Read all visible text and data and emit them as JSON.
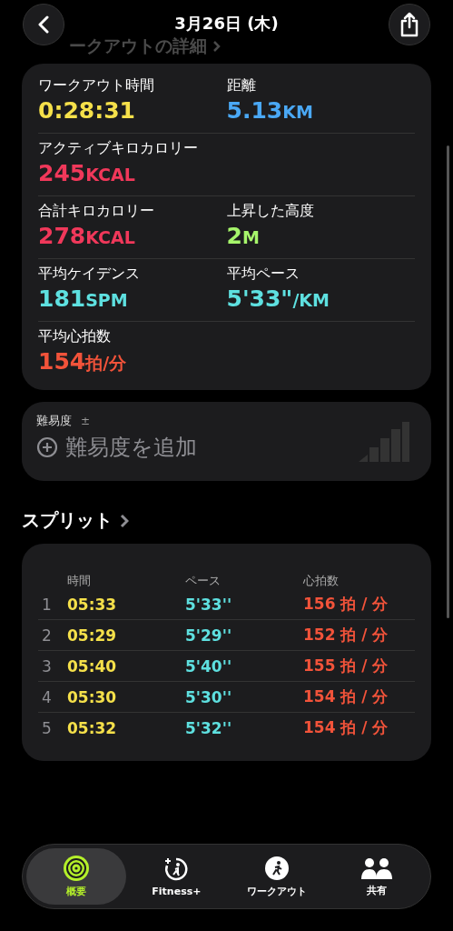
{
  "header": {
    "title": "3月26日 (木)",
    "section_title": "ークアウトの詳細"
  },
  "metrics": [
    {
      "label": "ワークアウト時間",
      "value": "0:28:31",
      "color": "#f5e04a"
    },
    {
      "label": "距離",
      "value": "5.13",
      "unit": "KM",
      "color": "#4aa8f5"
    },
    {
      "label": "アクティブキロカロリー",
      "value": "245",
      "unit": "KCAL",
      "color": "#f0385a"
    },
    {
      "label": "合計キロカロリー",
      "value": "278",
      "unit": "KCAL",
      "color": "#f0385a"
    },
    {
      "label": "上昇した高度",
      "value": "2",
      "unit": "M",
      "color": "#a6f56b"
    },
    {
      "label": "平均ケイデンス",
      "value": "181",
      "unit": "SPM",
      "color": "#5ee0e0"
    },
    {
      "label": "平均ペース",
      "value": "5'33\"",
      "unit": "/KM",
      "color": "#5ee0e0"
    },
    {
      "label": "平均心拍数",
      "value": "154",
      "unit": "拍/分",
      "color": "#f2533a"
    }
  ],
  "difficulty": {
    "label": "難易度",
    "mark": "±",
    "placeholder": "難易度を追加"
  },
  "splits": {
    "title": "スプリット",
    "columns": [
      "時間",
      "ペース",
      "心拍数"
    ],
    "rows": [
      {
        "index": "1",
        "time": "05:33",
        "pace": "5'33''",
        "heart_rate": "156 拍 / 分"
      },
      {
        "index": "2",
        "time": "05:29",
        "pace": "5'29''",
        "heart_rate": "152 拍 / 分"
      },
      {
        "index": "3",
        "time": "05:40",
        "pace": "5'40''",
        "heart_rate": "155 拍 / 分"
      },
      {
        "index": "4",
        "time": "05:30",
        "pace": "5'30''",
        "heart_rate": "154 拍 / 分"
      },
      {
        "index": "5",
        "time": "05:32",
        "pace": "5'32''",
        "heart_rate": "154 拍 / 分"
      }
    ]
  },
  "tab_bar": [
    {
      "kind": "summary",
      "label": "概要",
      "selected": true
    },
    {
      "kind": "fitness",
      "label": "Fitness+",
      "selected": false
    },
    {
      "kind": "workout",
      "label": "ワークアウト",
      "selected": false
    },
    {
      "kind": "sharing",
      "label": "共有",
      "selected": false
    }
  ]
}
